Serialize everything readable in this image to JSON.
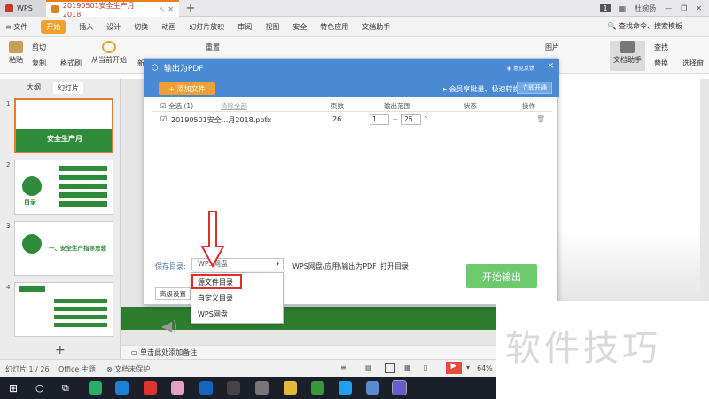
{
  "titlebar": {
    "wps_tab": "WPS",
    "doc_tab": "20190501安全生产月2018",
    "page_indicator": "1",
    "user": "杜婉扬"
  },
  "menu": {
    "file": "文件",
    "items": [
      "开始",
      "插入",
      "设计",
      "切换",
      "动画",
      "幻灯片放映",
      "审阅",
      "视图",
      "安全",
      "特色应用",
      "文档助手"
    ],
    "search": "查找命令、搜索模板"
  },
  "ribbon": {
    "paste": "粘贴",
    "cut": "剪切",
    "copy": "复制",
    "format_painter": "格式刷",
    "play_from_current": "从当前开始",
    "new": "新",
    "reset": "重置",
    "picture": "图片",
    "find": "查找",
    "replace": "替换",
    "doc_helper": "文档助手",
    "select_all": "选择窗"
  },
  "left_panel": {
    "tab_outline": "大纲",
    "tab_slides": "幻灯片",
    "slides": [
      {
        "num": "1",
        "title": "安全生产月"
      },
      {
        "num": "2",
        "title": "目录"
      },
      {
        "num": "3",
        "title": "一、安全生产指导思想"
      },
      {
        "num": "4",
        "title": ""
      }
    ]
  },
  "dialog": {
    "title": "输出为PDF",
    "help": "意见反馈",
    "add_file": "+ 添加文件",
    "member_text": "会员享批量、极速转换",
    "open_now": "立即开通",
    "header": {
      "select_all": "全选 (1)",
      "clear": "清除全部",
      "pages": "页数",
      "range": "输出范围",
      "status": "状态",
      "action": "操作"
    },
    "row": {
      "filename": "20190501安全...月2018.pptx",
      "pages": "26",
      "from": "1",
      "to": "26"
    },
    "save_label": "保存目录:",
    "save_value": "WPS网盘",
    "save_path": "WPS网盘\\应用\\输出为PDF",
    "open_dir": "打开目录",
    "start": "开始输出",
    "advanced": "高级设置",
    "dropdown": [
      "源文件目录",
      "自定义目录",
      "WPS网盘"
    ]
  },
  "notes": "单击此处添加备注",
  "status": {
    "slide": "幻灯片 1 / 26",
    "theme": "Office 主题",
    "protect": "文档未保护",
    "zoom": "64%"
  },
  "watermark": "软件技巧"
}
